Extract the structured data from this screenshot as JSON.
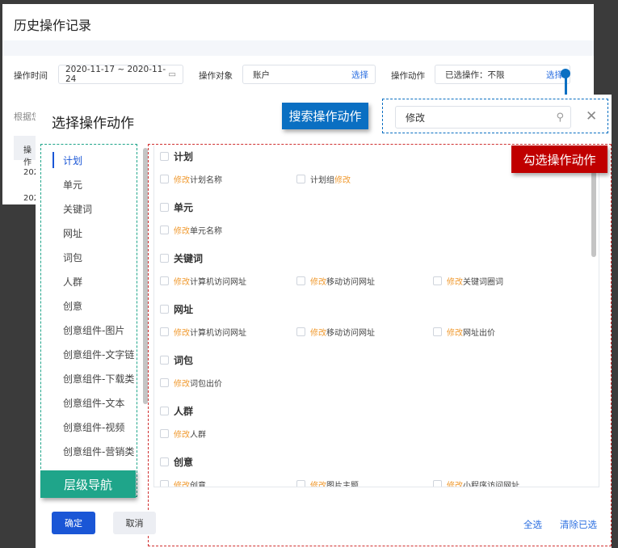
{
  "background": {
    "title": "历史操作记录",
    "filters": {
      "time_label": "操作时间",
      "time_value": "2020-11-17 ~ 2020-11-24",
      "object_label": "操作对象",
      "object_value": "账户",
      "object_select": "选择",
      "action_label": "操作动作",
      "action_value": "已选操作：不限",
      "action_select": "选择"
    },
    "hint": "根据您",
    "table_header": "操作",
    "rows": [
      "202",
      "202"
    ]
  },
  "modal": {
    "title": "选择操作动作",
    "search_value": "修改",
    "nav": [
      "计划",
      "单元",
      "关键词",
      "网址",
      "词包",
      "人群",
      "创意",
      "创意组件-图片",
      "创意组件-文字链",
      "创意组件-下载类",
      "创意组件-文本",
      "创意组件-视频",
      "创意组件-营销类"
    ],
    "groups": [
      {
        "title": "计划",
        "items": [
          {
            "pre": "",
            "kw": "修改",
            "post": "计划名称"
          },
          {
            "pre": "计划组",
            "kw": "修改",
            "post": ""
          }
        ]
      },
      {
        "title": "单元",
        "items": [
          {
            "pre": "",
            "kw": "修改",
            "post": "单元名称"
          }
        ]
      },
      {
        "title": "关键词",
        "items": [
          {
            "pre": "",
            "kw": "修改",
            "post": "计算机访问网址"
          },
          {
            "pre": "",
            "kw": "修改",
            "post": "移动访问网址"
          },
          {
            "pre": "",
            "kw": "修改",
            "post": "关键词圈词"
          }
        ]
      },
      {
        "title": "网址",
        "items": [
          {
            "pre": "",
            "kw": "修改",
            "post": "计算机访问网址"
          },
          {
            "pre": "",
            "kw": "修改",
            "post": "移动访问网址"
          },
          {
            "pre": "",
            "kw": "修改",
            "post": "网址出价"
          }
        ]
      },
      {
        "title": "词包",
        "items": [
          {
            "pre": "",
            "kw": "修改",
            "post": "词包出价"
          }
        ]
      },
      {
        "title": "人群",
        "items": [
          {
            "pre": "",
            "kw": "修改",
            "post": "人群"
          }
        ]
      },
      {
        "title": "创意",
        "items": [
          {
            "pre": "",
            "kw": "修改",
            "post": "创意"
          },
          {
            "pre": "",
            "kw": "修改",
            "post": "图片主题"
          },
          {
            "pre": "",
            "kw": "修改",
            "post": "小程序访问网址"
          }
        ]
      }
    ],
    "confirm": "确定",
    "cancel": "取消",
    "select_all": "全选",
    "clear": "清除已选"
  },
  "annotations": {
    "search": "搜索操作动作",
    "check": "勾选操作动作",
    "nav": "层级导航"
  },
  "colors": {
    "primary": "#1a56d6",
    "keyword": "#f09a30",
    "annot_blue": "#0a6fc2",
    "annot_red": "#c00000",
    "annot_green": "#1fa58a"
  }
}
